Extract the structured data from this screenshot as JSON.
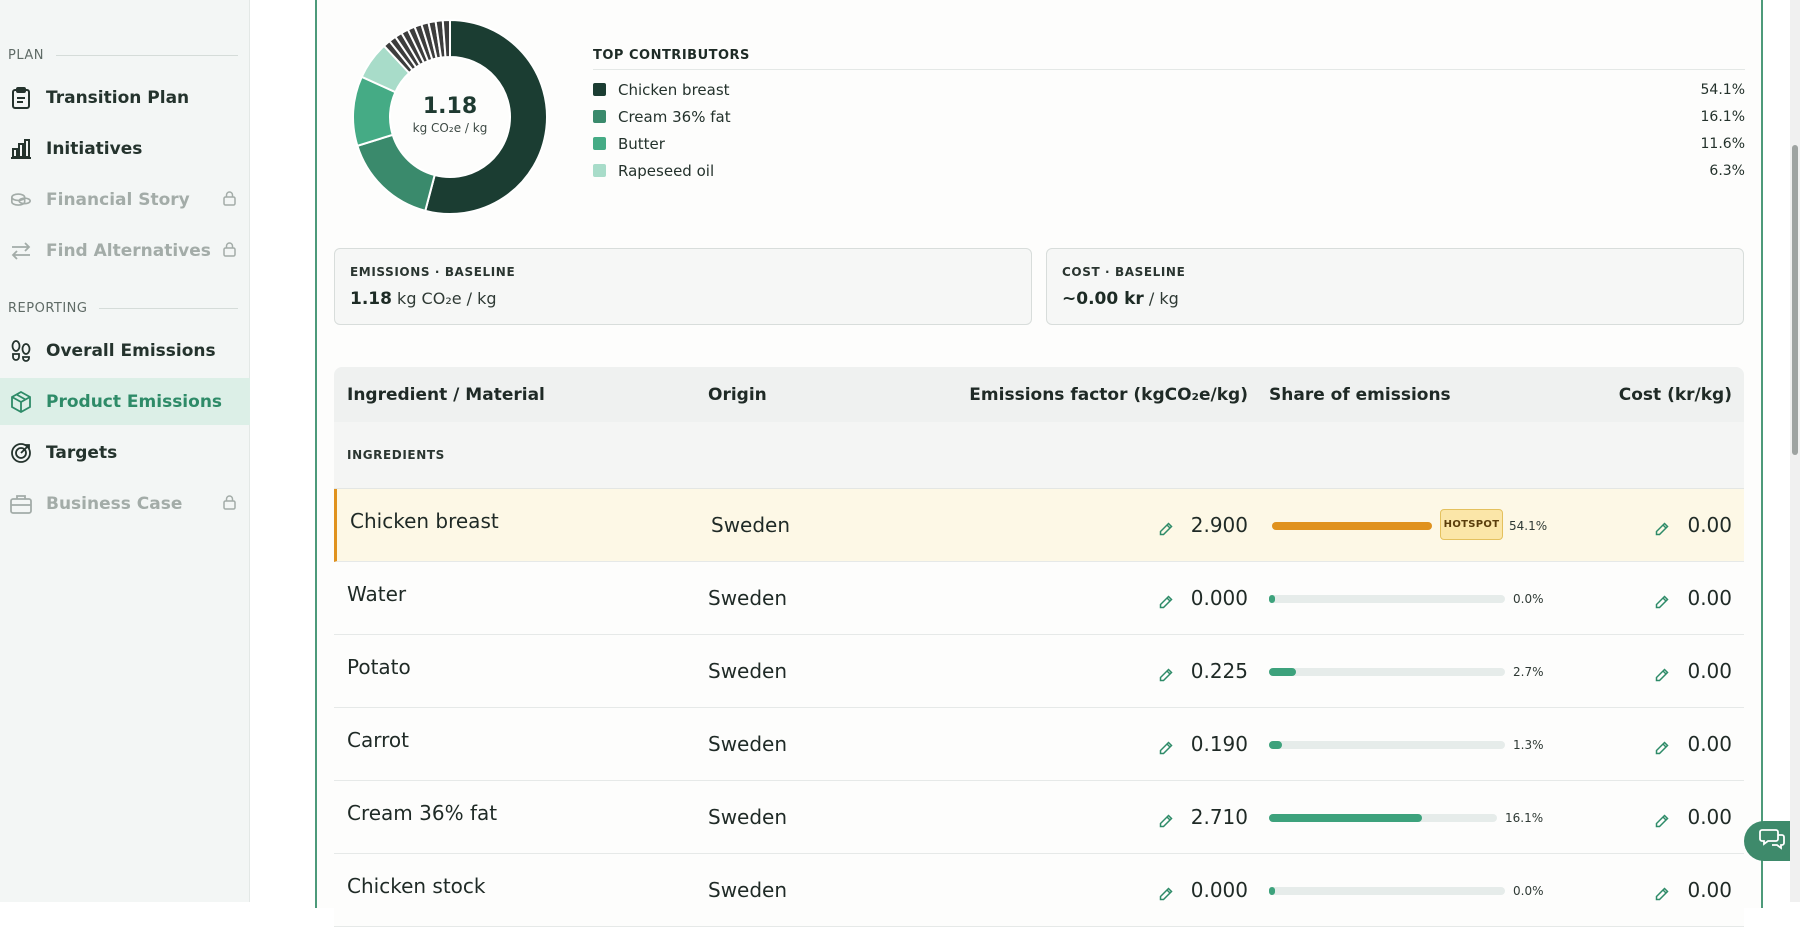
{
  "sidebar": {
    "plan_label": "PLAN",
    "reporting_label": "REPORTING",
    "items": [
      {
        "label": "Transition Plan",
        "icon": "clipboard-icon"
      },
      {
        "label": "Initiatives",
        "icon": "bar-chart-icon"
      },
      {
        "label": "Financial Story",
        "icon": "coins-icon",
        "locked": true
      },
      {
        "label": "Find Alternatives",
        "icon": "swap-icon",
        "locked": true
      },
      {
        "label": "Overall Emissions",
        "icon": "footprints-icon"
      },
      {
        "label": "Product Emissions",
        "icon": "box-icon",
        "active": true
      },
      {
        "label": "Targets",
        "icon": "target-icon"
      },
      {
        "label": "Business Case",
        "icon": "briefcase-icon",
        "locked": true
      }
    ]
  },
  "donut": {
    "value": "1.18",
    "unit": "kg CO₂e / kg"
  },
  "chart_data": {
    "type": "pie",
    "categories": [
      "Chicken breast",
      "Cream 36% fat",
      "Butter",
      "Rapeseed oil",
      "Other"
    ],
    "values": [
      54.1,
      16.1,
      11.6,
      6.3,
      11.9
    ],
    "colors": [
      "#1b3d32",
      "#3a8a6c",
      "#45ab85",
      "#a8dcc9",
      "#3d3d3d"
    ]
  },
  "contributors": {
    "title": "TOP CONTRIBUTORS",
    "items": [
      {
        "name": "Chicken breast",
        "pct": "54.1%",
        "color": "#1b3d32"
      },
      {
        "name": "Cream 36% fat",
        "pct": "16.1%",
        "color": "#3a8a6c"
      },
      {
        "name": "Butter",
        "pct": "11.6%",
        "color": "#45ab85"
      },
      {
        "name": "Rapeseed oil",
        "pct": "6.3%",
        "color": "#a8dcc9"
      }
    ]
  },
  "cards": {
    "emissions": {
      "title": "EMISSIONS · BASELINE",
      "value": "1.18",
      "unit": "kg CO₂e / kg"
    },
    "cost": {
      "title": "COST · BASELINE",
      "value": "~0.00 kr",
      "unit": "/ kg"
    }
  },
  "table": {
    "headers": {
      "name": "Ingredient / Material",
      "origin": "Origin",
      "ef": "Emissions factor (kgCO₂e/kg)",
      "share": "Share of emissions",
      "cost": "Cost (kr/kg)"
    },
    "group": "INGREDIENTS",
    "hotspot_label": "HOTSPOT",
    "rows": [
      {
        "name": "Chicken breast",
        "origin": "Sweden",
        "ef": "2.900",
        "share": "54.1%",
        "share_value": 54.1,
        "cost": "0.00",
        "hot": true
      },
      {
        "name": "Water",
        "origin": "Sweden",
        "ef": "0.000",
        "share": "0.0%",
        "share_value": 0.0,
        "cost": "0.00"
      },
      {
        "name": "Potato",
        "origin": "Sweden",
        "ef": "0.225",
        "share": "2.7%",
        "share_value": 2.7,
        "cost": "0.00"
      },
      {
        "name": "Carrot",
        "origin": "Sweden",
        "ef": "0.190",
        "share": "1.3%",
        "share_value": 1.3,
        "cost": "0.00"
      },
      {
        "name": "Cream 36% fat",
        "origin": "Sweden",
        "ef": "2.710",
        "share": "16.1%",
        "share_value": 16.1,
        "cost": "0.00"
      },
      {
        "name": "Chicken stock",
        "origin": "Sweden",
        "ef": "0.000",
        "share": "0.0%",
        "share_value": 0.0,
        "cost": "0.00"
      }
    ]
  },
  "colors": {
    "accent": "#3da27c",
    "hotspot_bar": "#e0921e"
  }
}
